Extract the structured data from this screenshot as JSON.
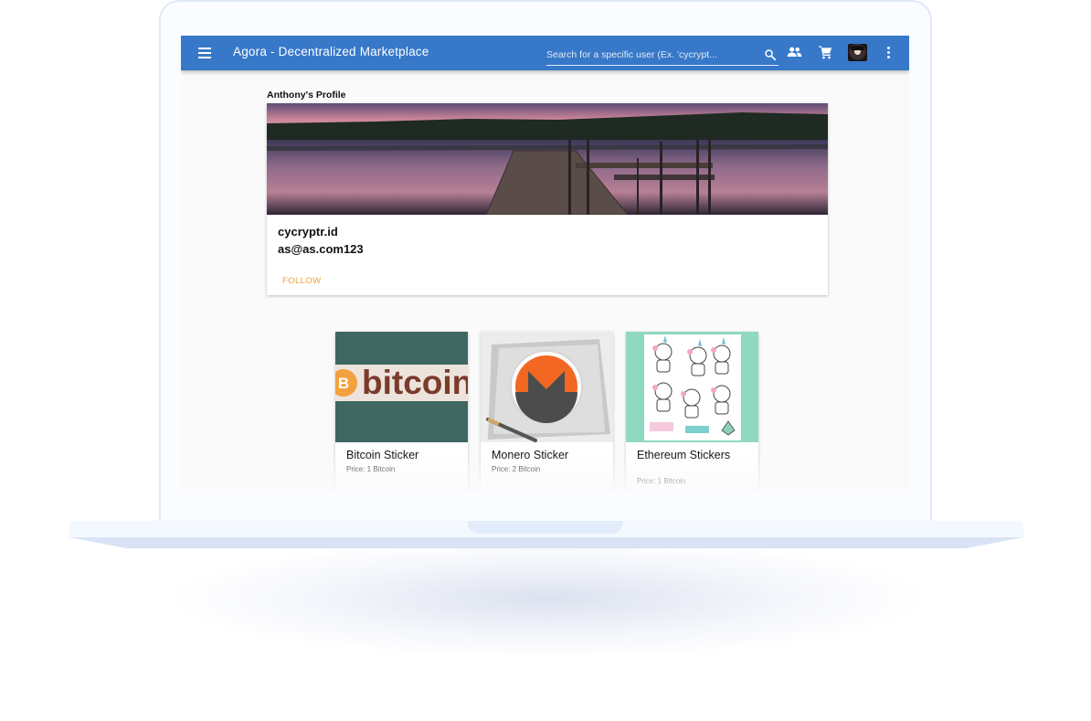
{
  "app": {
    "title": "Agora - Decentralized Marketplace",
    "search_placeholder": "Search for a specific user (Ex. 'cycrypt...",
    "colors": {
      "toolbar": "#3778c9",
      "follow": "#e8a33a",
      "background": "#fafafa"
    },
    "icons": [
      "menu-icon",
      "search-icon",
      "people-icon",
      "cart-icon",
      "avatar",
      "more-vert-icon"
    ]
  },
  "profile": {
    "heading": "Anthony's Profile",
    "username": "cycryptr.id",
    "email": "as@as.com123",
    "follow_label": "FOLLOW"
  },
  "products": [
    {
      "name": "Bitcoin Sticker",
      "price": "Price: 1 Bitcoin",
      "image_text": "bitcoin"
    },
    {
      "name": "Monero Sticker",
      "price": "Price: 2 Bitcoin"
    },
    {
      "name": "Ethereum Stickers",
      "price": "Price: 1 Bitcoin"
    }
  ]
}
